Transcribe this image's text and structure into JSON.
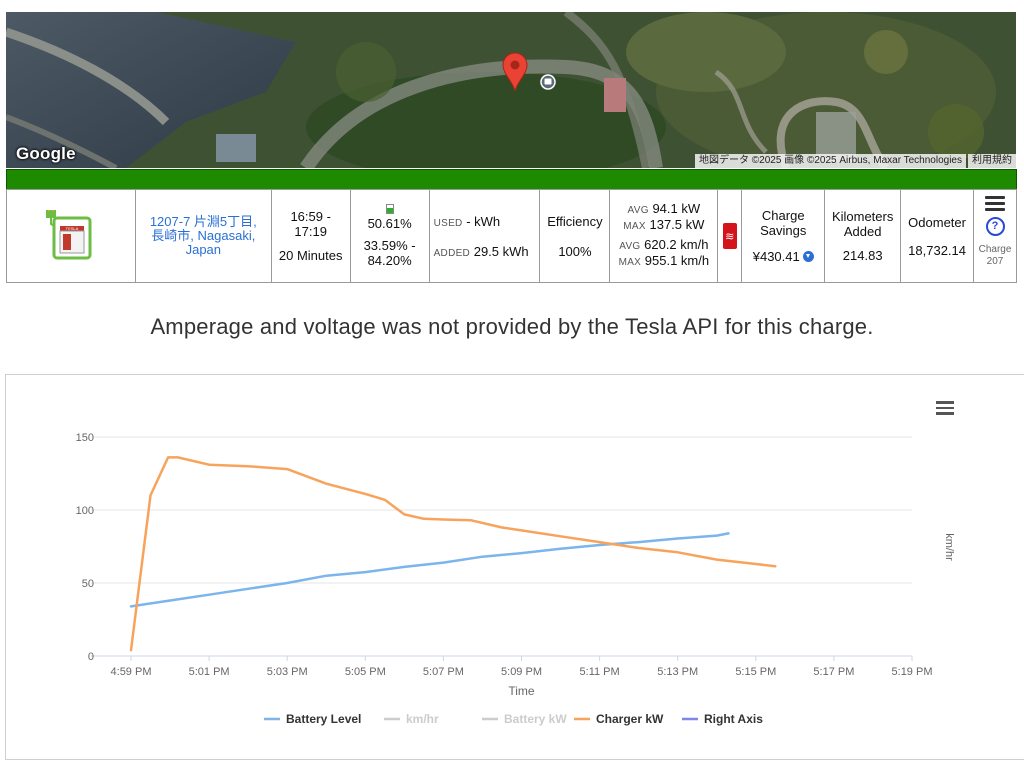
{
  "map": {
    "logo": "Google",
    "attribution": "地図データ ©2025 画像 ©2025 Airbus, Maxar Technologies",
    "terms": "利用規約",
    "pin_icon": "map-pin-icon",
    "poi_icon": "bus-stop-icon"
  },
  "summary": {
    "charger_icon": "supercharger-icon",
    "location": "1207-7 片淵5丁目, 長崎市, Nagasaki, Japan",
    "time_range": "16:59 - 17:19",
    "duration": "20 Minutes",
    "battery_level": "50.61%",
    "battery_range": "33.59% - 84.20%",
    "used_label": "USED",
    "used_value": "- kWh",
    "added_label": "ADDED",
    "added_value": "29.5 kWh",
    "efficiency_label": "Efficiency",
    "efficiency_value": "100%",
    "avg_label": "AVG",
    "max_label": "MAX",
    "avg_power": "94.1 kW",
    "max_power": "137.5 kW",
    "avg_speed": "620.2 km/h",
    "max_speed": "955.1 km/h",
    "savings_label": "Charge Savings",
    "savings_value": "¥430.41",
    "km_added_label": "Kilometers Added",
    "km_added_value": "214.83",
    "odometer_label": "Odometer",
    "odometer_value": "18,732.14",
    "charge_label": "Charge",
    "charge_number": "207",
    "colors": {
      "green_bar": "#1e8a00",
      "link": "#2a6fd4",
      "badge": "#d4141b"
    }
  },
  "note": "Amperage and voltage was not provided by the Tesla API for this charge.",
  "chart_data": {
    "type": "line",
    "xlabel": "Time",
    "ylabel": "",
    "right_axis_label": "km/hr",
    "x_ticks": [
      "4:59 PM",
      "5:01 PM",
      "5:03 PM",
      "5:05 PM",
      "5:07 PM",
      "5:09 PM",
      "5:11 PM",
      "5:13 PM",
      "5:15 PM",
      "5:17 PM",
      "5:19 PM"
    ],
    "x_range_minutes": [
      0,
      20
    ],
    "ylim": [
      0,
      150
    ],
    "y_ticks": [
      0,
      50,
      100,
      150
    ],
    "grid": true,
    "legend_position": "bottom",
    "legend": [
      {
        "name": "Battery Level",
        "color": "#7cb5ec",
        "visible": true
      },
      {
        "name": "km/hr",
        "color": "#cccccc",
        "visible": false
      },
      {
        "name": "Battery kW",
        "color": "#cccccc",
        "visible": false
      },
      {
        "name": "Charger kW",
        "color": "#f7a35c",
        "visible": true
      },
      {
        "name": "Right Axis",
        "color": "#8085e9",
        "visible": true
      }
    ],
    "series": [
      {
        "name": "Battery Level",
        "color": "#7cb5ec",
        "points": [
          [
            0,
            34
          ],
          [
            1,
            38
          ],
          [
            2,
            42
          ],
          [
            3,
            46
          ],
          [
            4,
            50
          ],
          [
            5,
            55
          ],
          [
            6,
            57.5
          ],
          [
            7,
            61
          ],
          [
            8,
            64
          ],
          [
            9,
            68
          ],
          [
            10,
            70.5
          ],
          [
            11,
            73.5
          ],
          [
            12,
            76
          ],
          [
            13,
            78
          ],
          [
            14,
            80.5
          ],
          [
            15,
            82.5
          ],
          [
            15.3,
            84
          ]
        ]
      },
      {
        "name": "Charger kW",
        "color": "#f7a35c",
        "points": [
          [
            0,
            4
          ],
          [
            0.5,
            110
          ],
          [
            0.95,
            136
          ],
          [
            1.2,
            136
          ],
          [
            2,
            131
          ],
          [
            3,
            130
          ],
          [
            4,
            128
          ],
          [
            5,
            118
          ],
          [
            6,
            111
          ],
          [
            6.5,
            107
          ],
          [
            7,
            97
          ],
          [
            7.5,
            94
          ],
          [
            8,
            93.5
          ],
          [
            8.7,
            93
          ],
          [
            9.5,
            88
          ],
          [
            10,
            86
          ],
          [
            11,
            82
          ],
          [
            12,
            78
          ],
          [
            13,
            74
          ],
          [
            14,
            71
          ],
          [
            15,
            66
          ],
          [
            16,
            63
          ],
          [
            16.5,
            61.5
          ]
        ]
      }
    ]
  }
}
